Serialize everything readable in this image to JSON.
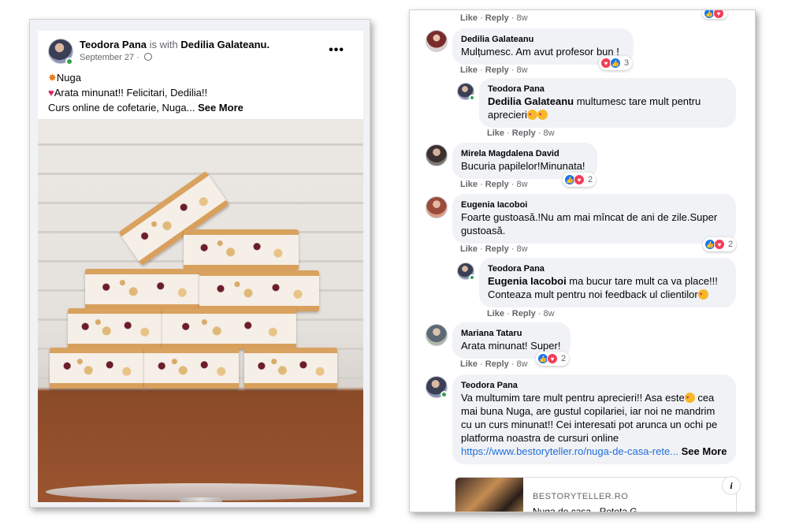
{
  "post": {
    "author": "Teodora Pana",
    "with_text": "is with",
    "tagged": "Dedilia Galateanu.",
    "date": "September 27 ·",
    "line1": "Nuga",
    "line2": "Arata minunat!! Felicitari, Dedilia!!",
    "line3": "Curs online de cofetarie, Nuga...",
    "see_more": "See More",
    "more_icon": "•••"
  },
  "comments": {
    "top_actions": {
      "like": "Like",
      "reply": "Reply",
      "time": "8w"
    },
    "items": [
      {
        "name": "Dedilia Galateanu",
        "text": "Mulțumesc. Am avut profesor bun !",
        "like": "Like",
        "reply": "Reply",
        "time": "8w",
        "reaction_count": "3"
      },
      {
        "name": "Teodora Pana",
        "tag": "Dedilia Galateanu",
        "text": " multumesc tare mult pentru aprecieri",
        "like": "Like",
        "reply": "Reply",
        "time": "8w"
      },
      {
        "name": "Mirela Magdalena David",
        "text": "Bucuria papilelor!Minunata!",
        "like": "Like",
        "reply": "Reply",
        "time": "8w",
        "reaction_count": "2"
      },
      {
        "name": "Eugenia Iacoboi",
        "text": "Foarte gustoasă.!Nu am mai mîncat de ani de zile.Super gustoasă.",
        "like": "Like",
        "reply": "Reply",
        "time": "8w",
        "reaction_count": "2"
      },
      {
        "name": "Teodora Pana",
        "tag": "Eugenia Iacoboi",
        "text": " ma bucur tare mult ca va place!!! Conteaza mult pentru noi feedback ul clientilor",
        "like": "Like",
        "reply": "Reply",
        "time": "8w"
      },
      {
        "name": "Mariana Tataru",
        "text": "Arata minunat! Super!",
        "like": "Like",
        "reply": "Reply",
        "time": "8w",
        "reaction_count": "2"
      },
      {
        "name": "Teodora Pana",
        "text_a": "Va multumim tare mult pentru aprecieri!! Asa este",
        "text_b": " cea mai buna Nuga, are gustul copilariei, iar noi ne mandrim cu un curs minunat!! Cei interesati pot arunca un ochi pe platforma noastra de cursuri online",
        "link": "https://www.bestoryteller.ro/nuga-de-casa-rete...",
        "see_more": " See More"
      }
    ],
    "link_card": {
      "domain": "BESTORYTELLER.RO",
      "title": "Nuga de casa · Reteta G..."
    }
  }
}
